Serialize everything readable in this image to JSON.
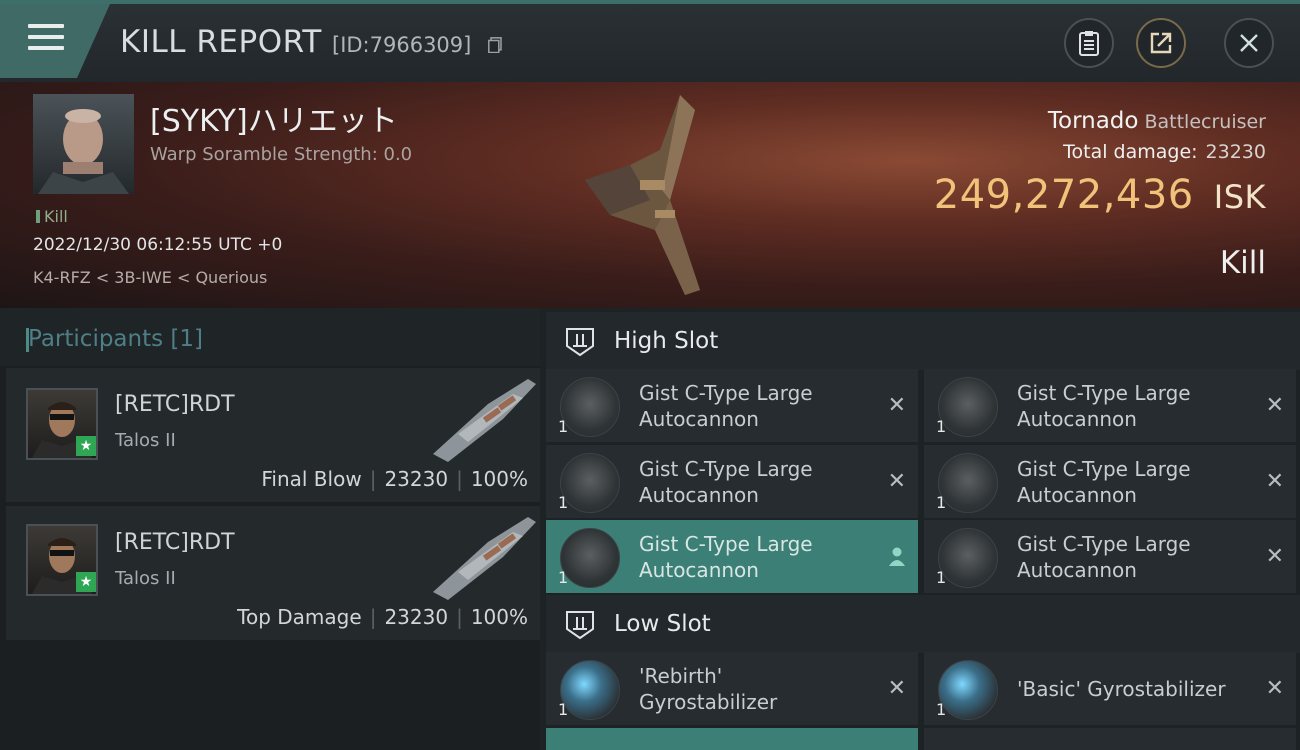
{
  "header": {
    "title": "KILL REPORT",
    "report_id": "[ID:7966309]"
  },
  "victim": {
    "name": "[SYKY]ハリエット",
    "warp_scramble": "Warp Soramble Strength: 0.0",
    "kill_tag": "Kill",
    "datetime": "2022/12/30 06:12:55 UTC +0",
    "location": "K4-RFZ < 3B-IWE < Querious",
    "ship": "Tornado",
    "ship_class": "Battlecruiser",
    "total_damage_label": "Total damage:",
    "total_damage": "23230",
    "isk_value": "249,272,436",
    "isk_unit": "ISK",
    "result": "Kill"
  },
  "participants": {
    "label": "Participants",
    "count": "[1]",
    "rows": [
      {
        "name": "[RETC]RDT",
        "ship": "Talos II",
        "role": "Final Blow",
        "damage": "23230",
        "percent": "100%"
      },
      {
        "name": "[RETC]RDT",
        "ship": "Talos II",
        "role": "Top Damage",
        "damage": "23230",
        "percent": "100%"
      }
    ]
  },
  "slots": {
    "high": {
      "label": "High Slot",
      "items": [
        {
          "qty": "1",
          "name_line1": "Gist C-Type Large",
          "name_line2": "Autocannon"
        },
        {
          "qty": "1",
          "name_line1": "Gist C-Type Large",
          "name_line2": "Autocannon"
        },
        {
          "qty": "1",
          "name_line1": "Gist C-Type Large",
          "name_line2": "Autocannon"
        },
        {
          "qty": "1",
          "name_line1": "Gist C-Type Large",
          "name_line2": "Autocannon"
        },
        {
          "qty": "1",
          "name_line1": "Gist C-Type Large",
          "name_line2": "Autocannon"
        },
        {
          "qty": "1",
          "name_line1": "Gist C-Type Large",
          "name_line2": "Autocannon"
        }
      ]
    },
    "low": {
      "label": "Low Slot",
      "items": [
        {
          "qty": "1",
          "name_line1": "'Rebirth'",
          "name_line2": "Gyrostabilizer"
        },
        {
          "qty": "1",
          "name_line1": "'Basic' Gyrostabilizer",
          "name_line2": ""
        }
      ]
    }
  },
  "icons": {
    "menu": "menu-icon",
    "copy": "copy-icon",
    "clipboard": "clipboard-icon",
    "share": "share-icon",
    "close": "close-icon",
    "slot": "slot-icon",
    "remove": "close-icon",
    "person": "person-icon"
  },
  "colors": {
    "accent": "#3f6a66",
    "isk": "#f1c27a",
    "active_item": "#3b7f76",
    "star_badge": "#2fa654"
  }
}
